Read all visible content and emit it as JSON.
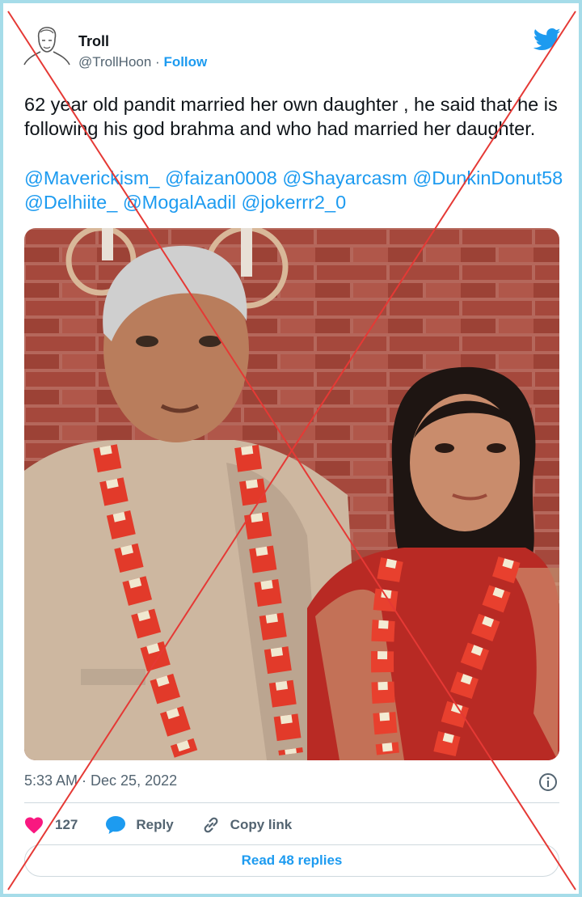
{
  "tweet": {
    "author_name": "Troll",
    "author_handle": "@TrollHoon",
    "separator": " · ",
    "follow_label": "Follow",
    "text": "62 year old pandit married her own daughter , he said that he is following his god brahma and who had married her daughter.",
    "mentions": [
      "@Maverickism_",
      "@faizan0008",
      "@Shayarcasm",
      "@DunkinDonut58",
      "@Delhiite_",
      "@MogalAadil",
      "@jokerrr2_0"
    ],
    "timestamp": "5:33 AM · Dec 25, 2022",
    "like_count": "127",
    "reply_label": "Reply",
    "copy_link_label": "Copy link",
    "read_replies_label": "Read 48 replies"
  },
  "icons": {
    "brand": "twitter-bird-icon",
    "like": "heart-icon",
    "reply": "speech-bubble-icon",
    "copy": "link-icon",
    "info": "info-icon"
  },
  "colors": {
    "accent": "#1d9bf0",
    "like": "#f91880",
    "text": "#0f1419",
    "muted": "#536471",
    "border": "#a6dce9",
    "cross": "#e53935"
  }
}
